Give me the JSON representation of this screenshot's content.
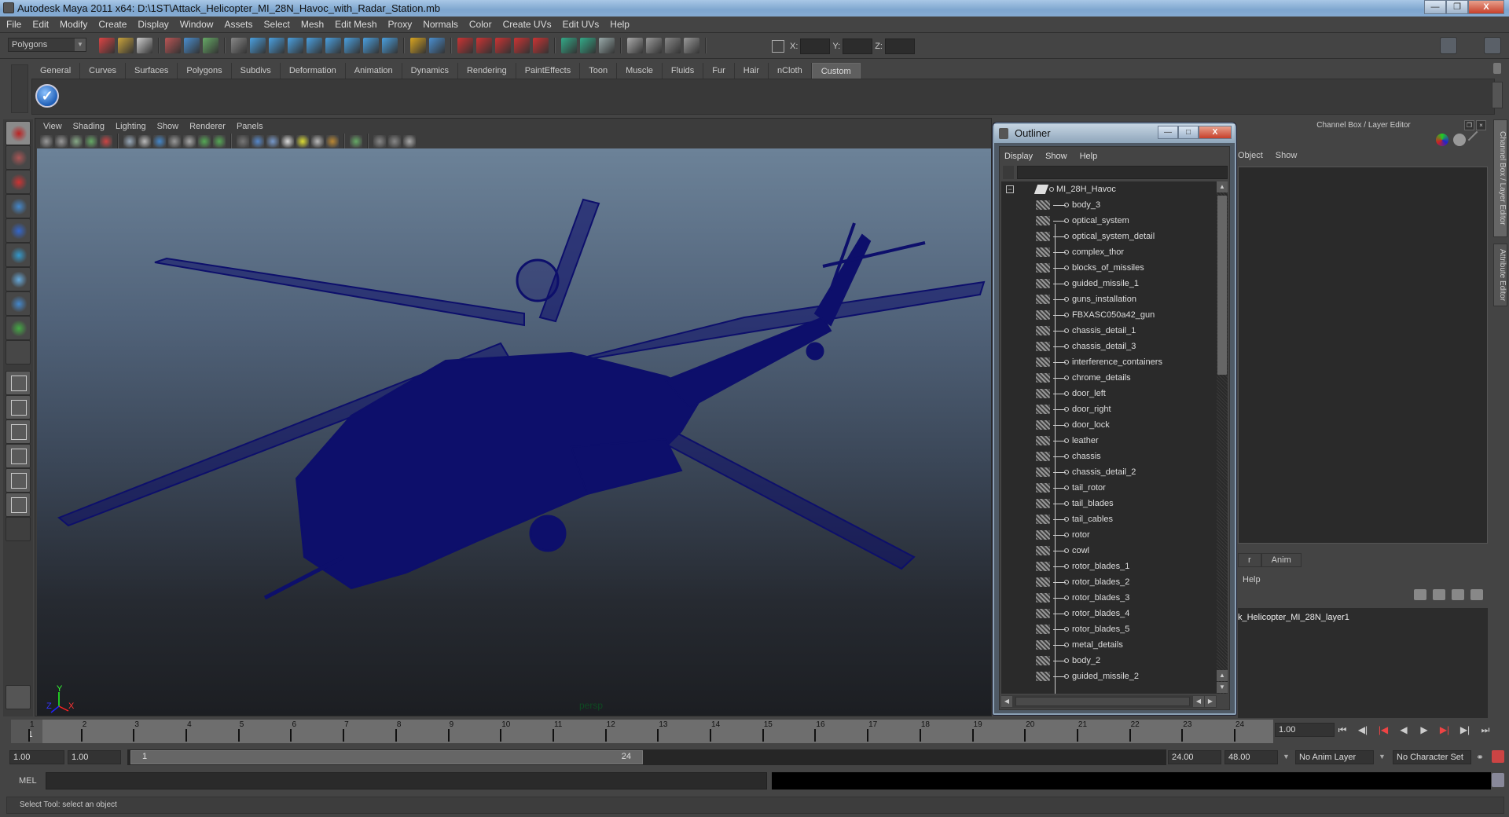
{
  "window": {
    "title": "Autodesk Maya 2011 x64: D:\\1ST\\Attack_Helicopter_MI_28N_Havoc_with_Radar_Station.mb",
    "controls": [
      "minimize",
      "restore",
      "close"
    ]
  },
  "menubar": [
    "File",
    "Edit",
    "Modify",
    "Create",
    "Display",
    "Window",
    "Assets",
    "Select",
    "Mesh",
    "Edit Mesh",
    "Proxy",
    "Normals",
    "Color",
    "Create UVs",
    "Edit UVs",
    "Help"
  ],
  "statusline": {
    "mode": "Polygons",
    "x_label": "X:",
    "y_label": "Y:",
    "z_label": "Z:",
    "x_value": "",
    "y_value": "",
    "z_value": ""
  },
  "shelf": {
    "tabs": [
      "General",
      "Curves",
      "Surfaces",
      "Polygons",
      "Subdivs",
      "Deformation",
      "Animation",
      "Dynamics",
      "Rendering",
      "PaintEffects",
      "Toon",
      "Muscle",
      "Fluids",
      "Fur",
      "Hair",
      "nCloth",
      "Custom"
    ],
    "active_tab": "Custom"
  },
  "toolbox": {
    "tools": [
      "select-tool",
      "lasso-tool",
      "paint-select-tool",
      "move-tool",
      "rotate-tool",
      "scale-tool",
      "universal-manipulator",
      "soft-modification",
      "show-manipulator",
      "last-tool"
    ],
    "layouts": [
      "single-perspective",
      "four-view",
      "outliner-persp",
      "persp-graph",
      "hypershade-persp",
      "persp-graph-outliner",
      "more-layouts"
    ]
  },
  "viewport": {
    "menu": [
      "View",
      "Shading",
      "Lighting",
      "Show",
      "Renderer",
      "Panels"
    ],
    "camera_label": "persp",
    "wireframe_color": "#0d0f6b",
    "axis": {
      "x": "X",
      "y": "Y",
      "z": "Z"
    }
  },
  "outliner": {
    "title": "Outliner",
    "menu": [
      "Display",
      "Show",
      "Help"
    ],
    "filter": "",
    "root": "MI_28H_Havoc",
    "items": [
      "body_3",
      "optical_system",
      "optical_system_detail",
      "complex_thor",
      "blocks_of_missiles",
      "guided_missile_1",
      "guns_installation",
      "FBXASC050a42_gun",
      "chassis_detail_1",
      "chassis_detail_3",
      "interference_containers",
      "chrome_details",
      "door_left",
      "door_right",
      "door_lock",
      "leather",
      "chassis",
      "chassis_detail_2",
      "tail_rotor",
      "tail_blades",
      "tail_cables",
      "rotor",
      "cowl",
      "rotor_blades_1",
      "rotor_blades_2",
      "rotor_blades_3",
      "rotor_blades_4",
      "rotor_blades_5",
      "metal_details",
      "body_2",
      "guided_missile_2"
    ]
  },
  "channel_box": {
    "title": "Channel Box / Layer Editor",
    "menu": [
      "Object",
      "Show"
    ],
    "layer_tabs": [
      "r",
      "Anim"
    ],
    "layer_menu_help": "Help",
    "layer_name": "k_Helicopter_MI_28N_layer1"
  },
  "side_tabs": [
    "Channel Box / Layer Editor",
    "Attribute Editor"
  ],
  "timeline": {
    "start": 1,
    "end": 24,
    "current_frame_label": "1",
    "current_time": "1.00",
    "ticks": [
      "1",
      "2",
      "3",
      "4",
      "5",
      "6",
      "7",
      "8",
      "9",
      "10",
      "11",
      "12",
      "13",
      "14",
      "15",
      "16",
      "17",
      "18",
      "19",
      "20",
      "21",
      "22",
      "23",
      "24"
    ]
  },
  "range": {
    "start_time": "1.00",
    "playback_start": "1.00",
    "range_start_label": "1",
    "range_end_label": "24",
    "playback_end": "24.00",
    "end_time": "48.00",
    "anim_layer": "No Anim Layer",
    "character_set": "No Character Set"
  },
  "command_line": {
    "label": "MEL",
    "value": ""
  },
  "help_line": "Select Tool: select an object"
}
